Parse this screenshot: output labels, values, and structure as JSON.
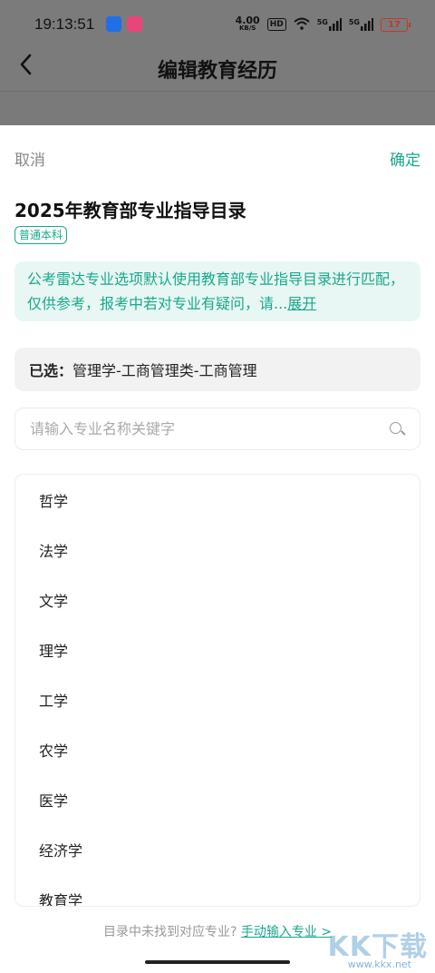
{
  "status_bar": {
    "time": "19:13:51",
    "net_speed_value": "4.00",
    "net_speed_unit": "KB/S",
    "hd_label": "HD",
    "signal1": "5G",
    "signal2": "5G",
    "battery": "17"
  },
  "header": {
    "back_icon": "chevron-left-icon",
    "title": "编辑教育经历"
  },
  "sheet": {
    "cancel_label": "取消",
    "confirm_label": "确定",
    "catalog_title": "2025年教育部专业指导目录",
    "badge": "普通本科",
    "notice_text": "公考雷达专业选项默认使用教育部专业指导目录进行匹配，仅供参考，报考中若对专业有疑问，请...",
    "notice_expand": "展开",
    "selected_label": "已选：",
    "selected_value": "管理学-工商管理类-工商管理",
    "search_placeholder": "请输入专业名称关键字",
    "categories": [
      "哲学",
      "法学",
      "文学",
      "理学",
      "工学",
      "农学",
      "医学",
      "经济学",
      "教育学"
    ],
    "footer_text": "目录中未找到对应专业?",
    "footer_link": "手动输入专业 >"
  },
  "watermark": {
    "text": "KK下载",
    "url": "www.kkx.net"
  },
  "colors": {
    "accent": "#19a88e",
    "dim_overlay": "#7b7b7b"
  }
}
